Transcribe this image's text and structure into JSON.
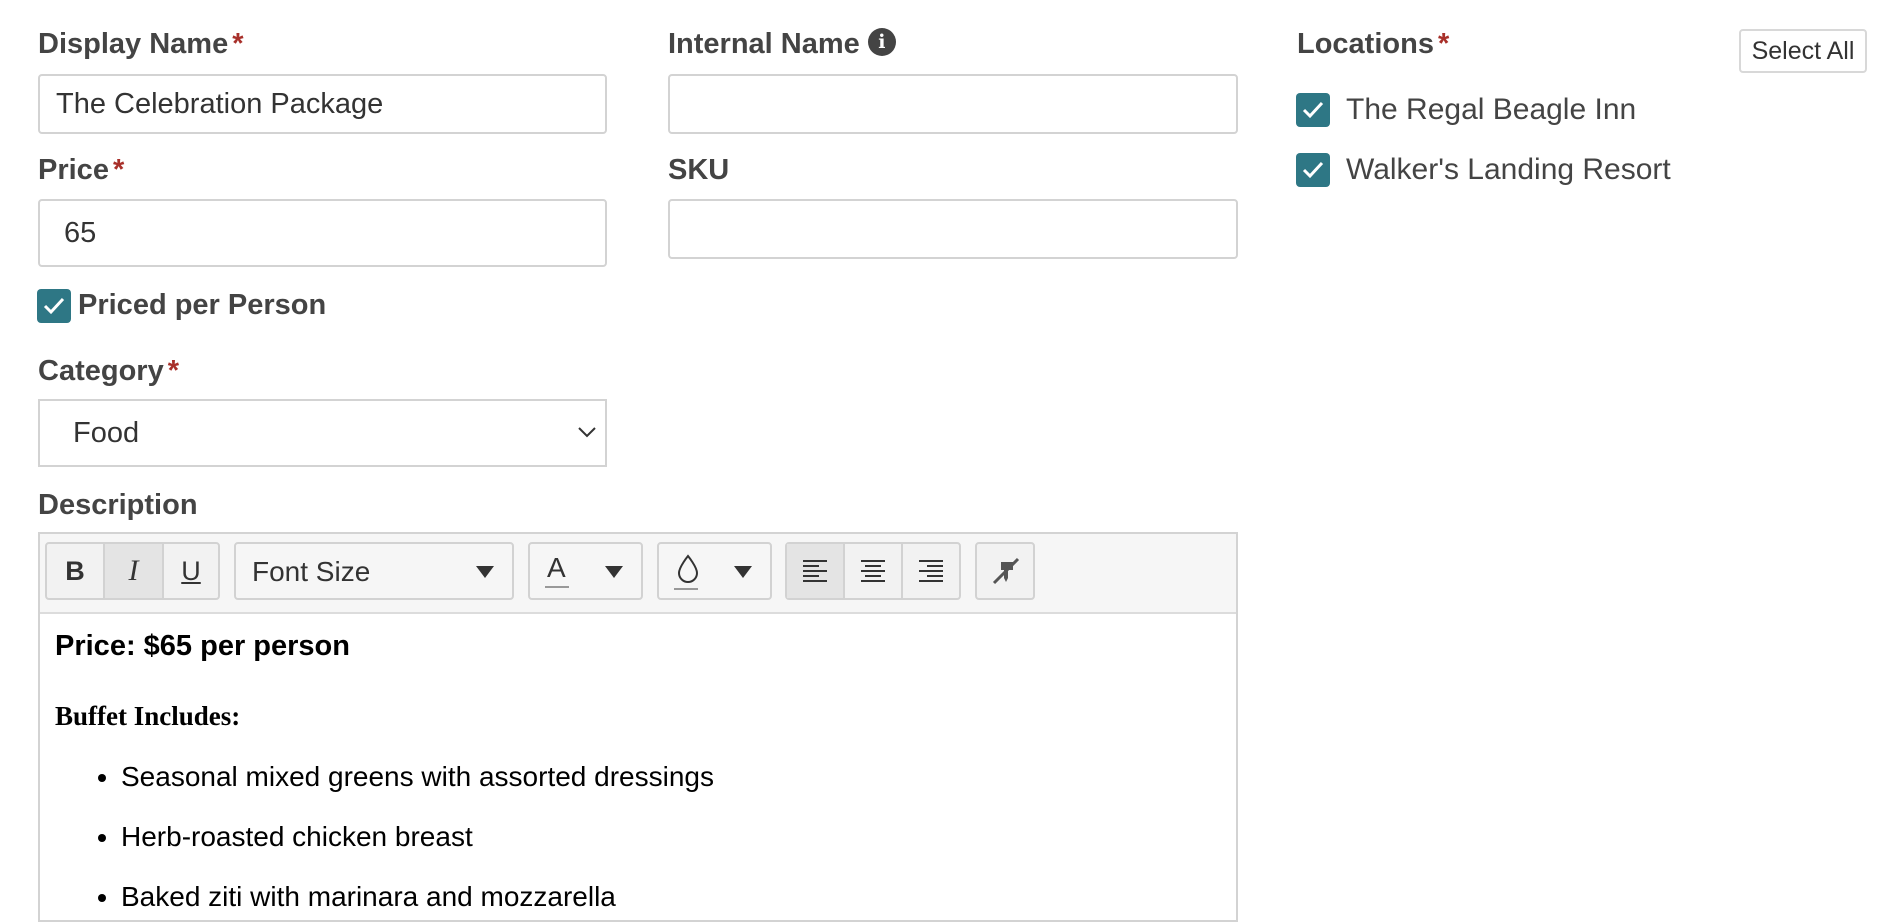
{
  "display_name": {
    "label": "Display Name",
    "required": "*",
    "value": "The Celebration Package"
  },
  "internal_name": {
    "label": "Internal Name",
    "value": ""
  },
  "price": {
    "label": "Price",
    "required": "*",
    "value": "65"
  },
  "sku": {
    "label": "SKU",
    "value": ""
  },
  "priced_per_person": {
    "label": "Priced per Person",
    "checked": true
  },
  "category": {
    "label": "Category",
    "required": "*",
    "selected": "Food"
  },
  "description": {
    "label": "Description",
    "toolbar": {
      "bold": "B",
      "italic": "I",
      "underline": "U",
      "font_size_placeholder": "Font Size",
      "font_color": "A"
    },
    "content": {
      "price_line": "Price: $65 per person",
      "heading": "Buffet Includes:",
      "items": [
        "Seasonal mixed greens with assorted dressings",
        "Herb-roasted chicken breast",
        "Baked ziti with marinara and mozzarella"
      ]
    }
  },
  "locations": {
    "label": "Locations",
    "required": "*",
    "select_all": "Select All",
    "items": [
      {
        "name": "The Regal Beagle Inn",
        "checked": true
      },
      {
        "name": "Walker's Landing Resort",
        "checked": true
      }
    ]
  },
  "colors": {
    "accent": "#2e7785",
    "required": "#a8302a",
    "label": "#444444"
  },
  "icons": [
    "info-icon",
    "check-icon",
    "chevron-down-icon",
    "caret-down-icon",
    "font-color-icon",
    "droplet-icon",
    "align-left-icon",
    "align-center-icon",
    "align-right-icon",
    "eraser-icon"
  ]
}
